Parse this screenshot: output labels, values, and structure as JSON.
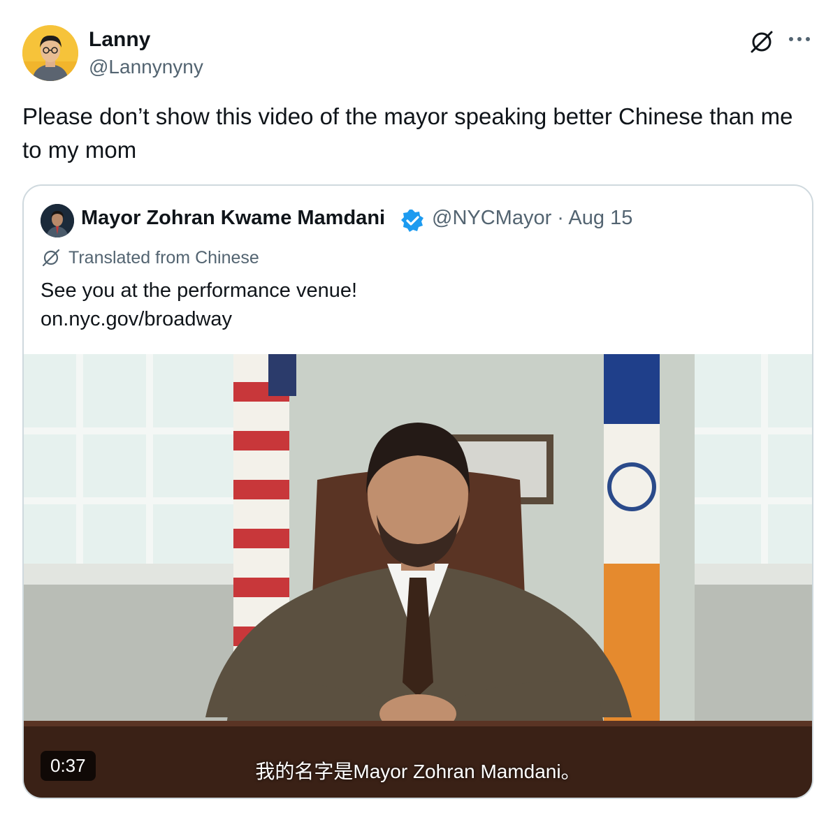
{
  "author": {
    "name": "Lanny",
    "handle": "@Lannynyny"
  },
  "icons": {
    "translate": "translate-icon",
    "more": "more-icon",
    "verified": "verified-badge-icon"
  },
  "tweet": {
    "text": "Please don’t show this video of the mayor speaking better Chinese than me to my mom"
  },
  "quoted": {
    "name": "Mayor Zohran Kwame Mamdani",
    "handle_date": "@NYCMayor · Aug 15",
    "translated_label": "Translated from Chinese",
    "text": "See you at the performance venue!\non.nyc.gov/broadway",
    "video": {
      "duration": "0:37",
      "caption": "我的名字是Mayor Zohran Mamdani。"
    }
  },
  "colors": {
    "text": "#0f1419",
    "secondary": "#536471",
    "border": "#cfd9de",
    "verified": "#1d9bf0"
  }
}
